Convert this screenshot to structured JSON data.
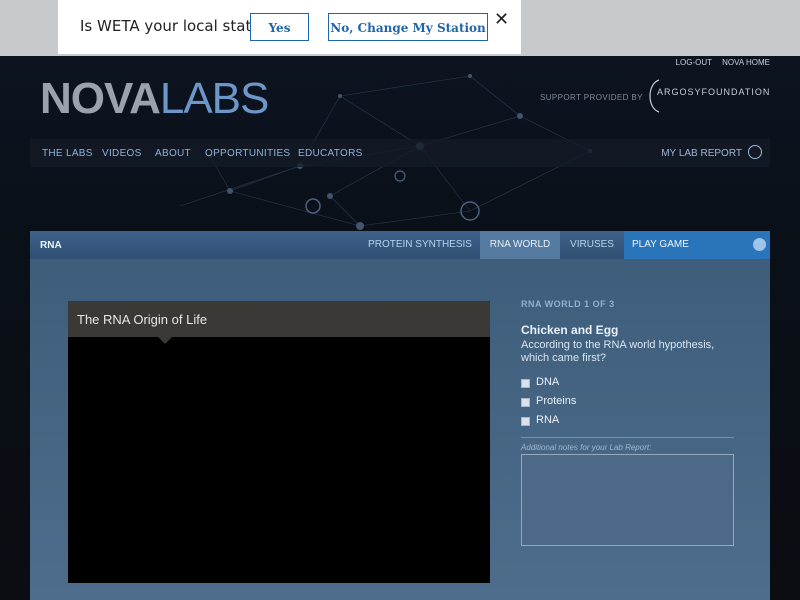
{
  "banner": {
    "question": "Is WETA your local station?",
    "yes": "Yes",
    "change": "No, Change My Station",
    "close": "✕"
  },
  "header": {
    "toplinks": [
      "LOG-OUT",
      "NOVA HOME"
    ],
    "logo_nova": "NOVA",
    "logo_labs": "LABS",
    "support": "SUPPORT PROVIDED BY",
    "sponsor": "ARGOSYFOUNDATION",
    "nav": [
      "THE LABS",
      "VIDEOS",
      "ABOUT",
      "OPPORTUNITIES",
      "EDUCATORS"
    ],
    "my_lab_report": "MY LAB REPORT"
  },
  "lab": {
    "title": "RNA",
    "tabs": [
      "PROTEIN SYNTHESIS",
      "RNA WORLD",
      "VIRUSES",
      "PLAY GAME"
    ],
    "active_tab": "RNA WORLD"
  },
  "video": {
    "title": "The RNA Origin of Life"
  },
  "quiz": {
    "step": "RNA WORLD 1 OF 3",
    "title": "Chicken and Egg",
    "question": "According to the RNA world hypothesis, which came first?",
    "options": [
      "DNA",
      "Proteins",
      "RNA"
    ],
    "notes_label": "Additional notes for your Lab Report:"
  },
  "colors": {
    "accent": "#2a74b9",
    "banner_button": "#1f66a8"
  }
}
